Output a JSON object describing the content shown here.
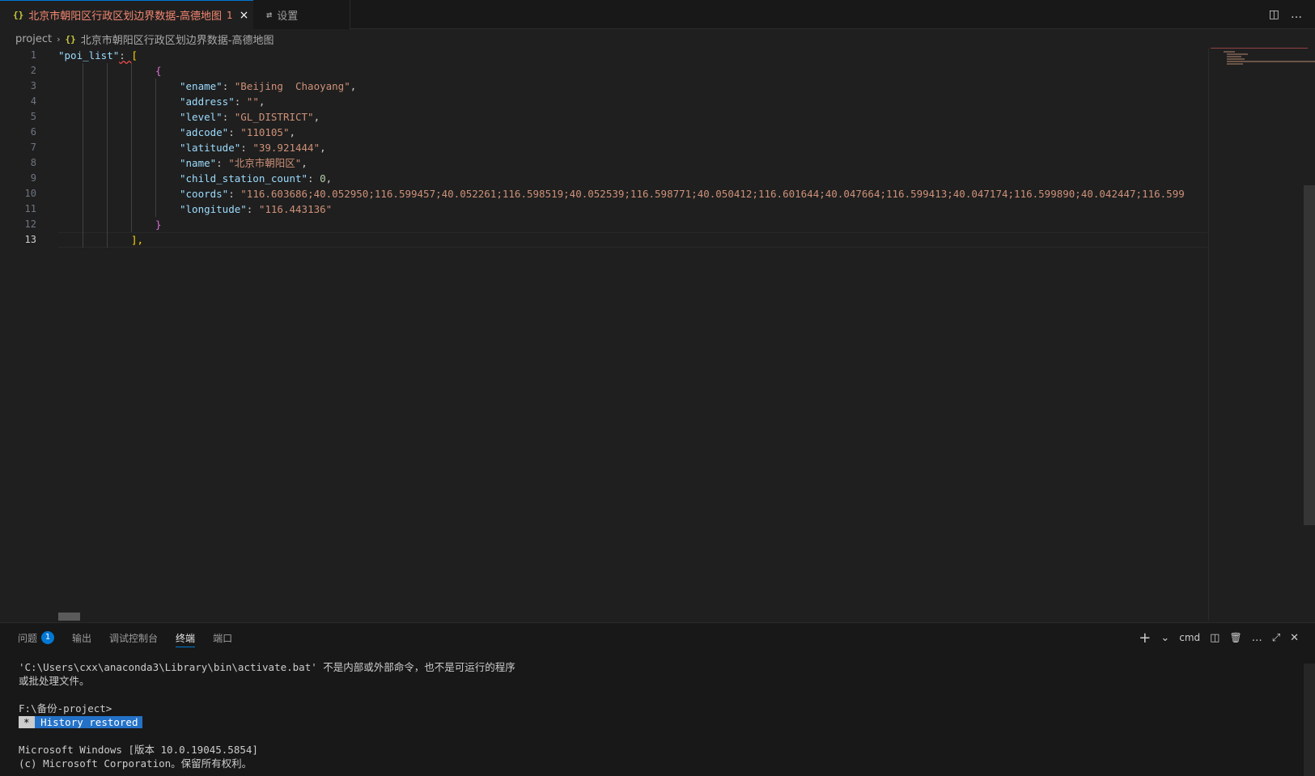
{
  "tabs": {
    "active": {
      "icon": "{}",
      "label": "北京市朝阳区行政区划边界数据-高德地图",
      "problems": "1",
      "close": "×"
    },
    "inactive": {
      "icon": "⇄",
      "label": "设置"
    },
    "split_icon": "◫",
    "more_icon": "…"
  },
  "breadcrumb": {
    "folder": "project",
    "sep": "›",
    "file_icon": "{}",
    "file": "北京市朝阳区行政区划边界数据-高德地图"
  },
  "editor": {
    "line_numbers": [
      "1",
      "2",
      "3",
      "4",
      "5",
      "6",
      "7",
      "8",
      "9",
      "10",
      "11",
      "12",
      "13"
    ],
    "current_line": "13",
    "lines": {
      "l1_key": "\"poi_list\"",
      "l1_colon": ": ",
      "l1_bracket": "[",
      "l2_brace": "{",
      "l3_key": "\"ename\"",
      "l3_val": "\"Beijing  Chaoyang\"",
      "l4_key": "\"address\"",
      "l4_val": "\"\"",
      "l5_key": "\"level\"",
      "l5_val": "\"GL_DISTRICT\"",
      "l6_key": "\"adcode\"",
      "l6_val": "\"110105\"",
      "l7_key": "\"latitude\"",
      "l7_val": "\"39.921444\"",
      "l8_key": "\"name\"",
      "l8_val": "\"北京市朝阳区\"",
      "l9_key": "\"child_station_count\"",
      "l9_val": "0",
      "l10_key": "\"coords\"",
      "l10_val": "\"116.603686;40.052950;116.599457;40.052261;116.598519;40.052539;116.598771;40.050412;116.601644;40.047664;116.599413;40.047174;116.599890;40.042447;116.599",
      "l11_key": "\"longitude\"",
      "l11_val": "\"116.443136\"",
      "l12_brace": "}",
      "l13_bracket": "],"
    }
  },
  "panel": {
    "tabs": [
      "问题",
      "输出",
      "调试控制台",
      "终端",
      "端口"
    ],
    "problems_count": "1",
    "active_tab": "终端",
    "actions": {
      "add": "+",
      "dropdown": "⌄",
      "shell": "cmd",
      "split": "◫",
      "trash": "🗑",
      "more": "…",
      "maximize": "⤢",
      "close": "✕"
    },
    "terminal": [
      "'C:\\Users\\cxx\\anaconda3\\Library\\bin\\activate.bat' 不是内部或外部命令，也不是可运行的程序",
      "或批处理文件。",
      "",
      "F:\\备份-project>",
      "",
      "",
      "Microsoft Windows [版本 10.0.19045.5854]",
      "(c) Microsoft Corporation。保留所有权利。"
    ],
    "history_star": "*",
    "history_text": "History restored"
  },
  "colors": {
    "accent": "#0078d4",
    "error": "#f48771",
    "string": "#ce9178",
    "key": "#9cdcfe"
  }
}
